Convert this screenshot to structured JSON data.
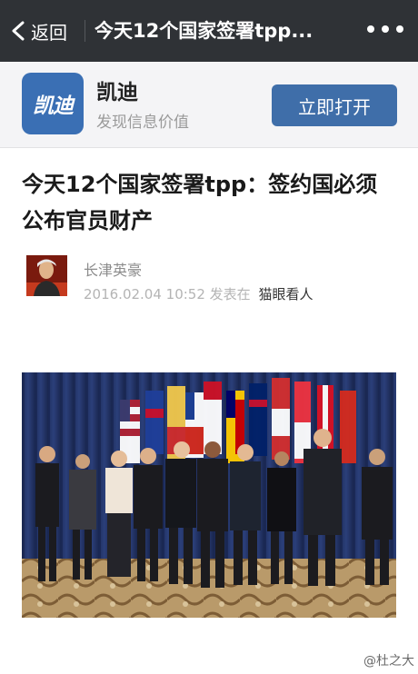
{
  "navbar": {
    "back_label": "返回",
    "title": "今天12个国家签署tpp...",
    "more_icon": "more-dots-icon"
  },
  "app_banner": {
    "logo_text": "凯迪",
    "name": "凯迪",
    "slogan": "发现信息价值",
    "open_button": "立即打开",
    "brand_color": "#3f6ea9"
  },
  "article": {
    "title": "今天12个国家签署tpp：签约国必须公布官员财产",
    "author": "长津英豪",
    "date": "2016.02.04 10:52",
    "published_in_label": "发表在",
    "publisher": "猫眼看人"
  },
  "watermark": "@杜之大"
}
